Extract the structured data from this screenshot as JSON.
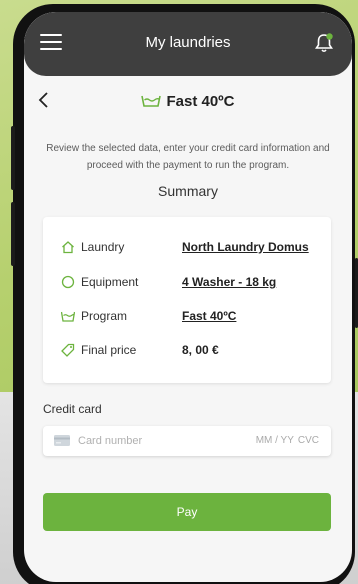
{
  "header": {
    "title": "My laundries"
  },
  "page": {
    "title": "Fast 40ºC"
  },
  "description": "Review the selected data, enter your credit card information and proceed with the payment to run the program.",
  "summary": {
    "heading": "Summary",
    "rows": [
      {
        "label": "Laundry",
        "value": "North Laundry Domus",
        "icon": "home-icon"
      },
      {
        "label": "Equipment",
        "value": "4 Washer - 18 kg",
        "icon": "circle-icon"
      },
      {
        "label": "Program",
        "value": "Fast 40ºC",
        "icon": "washing-program-icon"
      },
      {
        "label": "Final price",
        "value": "8, 00 €",
        "icon": "tag-icon"
      }
    ]
  },
  "credit_card": {
    "label": "Credit card",
    "number_placeholder": "Card number",
    "expiry_placeholder": "MM / YY",
    "cvc_placeholder": "CVC"
  },
  "pay": {
    "label": "Pay"
  },
  "colors": {
    "accent": "#6cb33e",
    "appbar": "#3f3f3f",
    "background_top": "#b6d06e"
  }
}
